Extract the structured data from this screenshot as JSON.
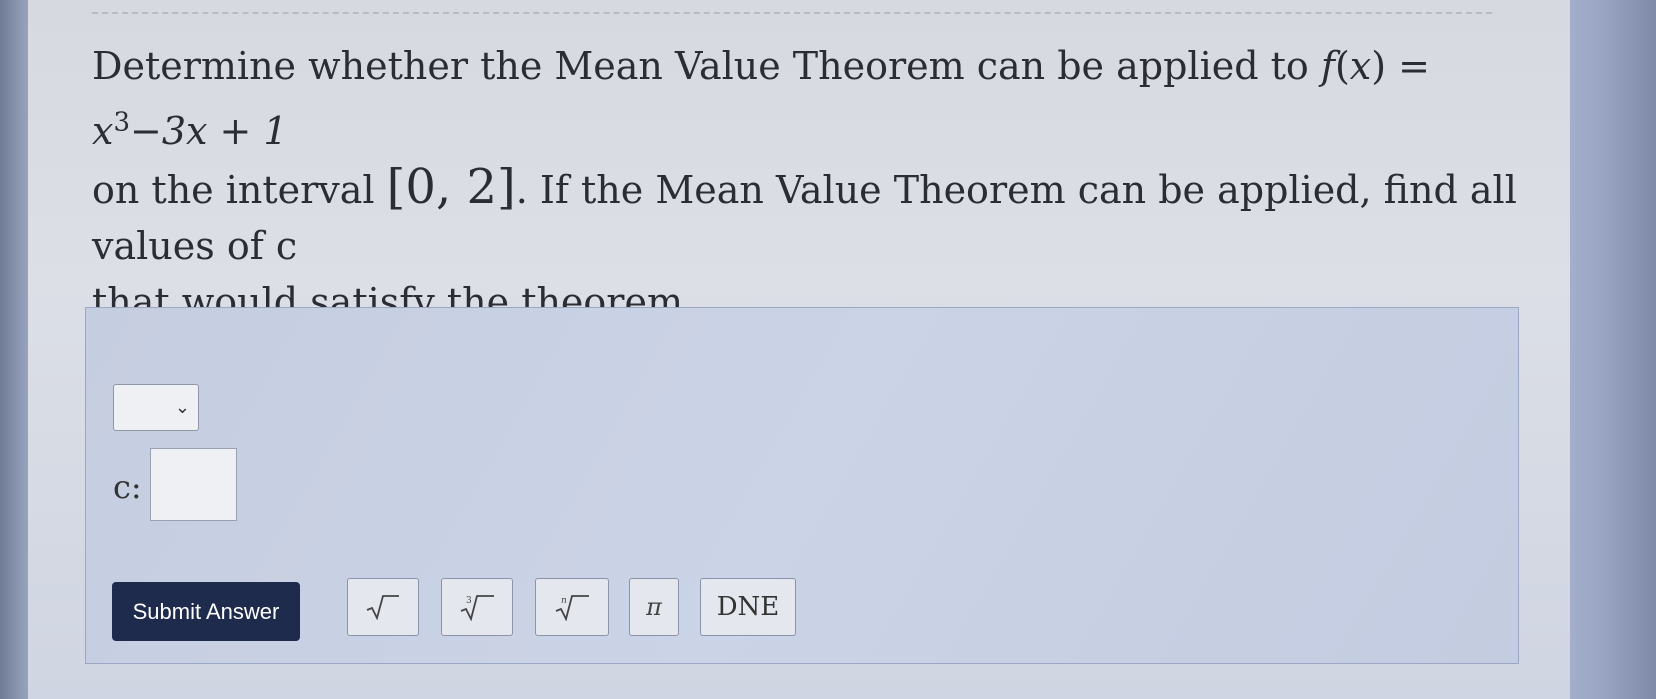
{
  "question": {
    "line1_text": "Determine whether the Mean Value Theorem can be applied to",
    "function_name": "f",
    "function_var": "x",
    "function_rhs_power": "3",
    "function_rhs_rest": "−3x + 1",
    "line2_prefix": "on the interval",
    "interval": "[0, 2]",
    "line2_suffix": ". If the Mean Value Theorem can be applied, find all values of c",
    "line3": "that would satisfy the theorem."
  },
  "answer": {
    "select_value": "",
    "c_label": "c:",
    "c_value": ""
  },
  "toolbar": {
    "submit_label": "Submit Answer",
    "pi_label": "π",
    "dne_label": "DNE",
    "cube_root_index": "3",
    "nth_root_index": "n"
  },
  "colors": {
    "submit_bg": "#1f2b4d",
    "panel_bg": "#c8d0e3"
  }
}
